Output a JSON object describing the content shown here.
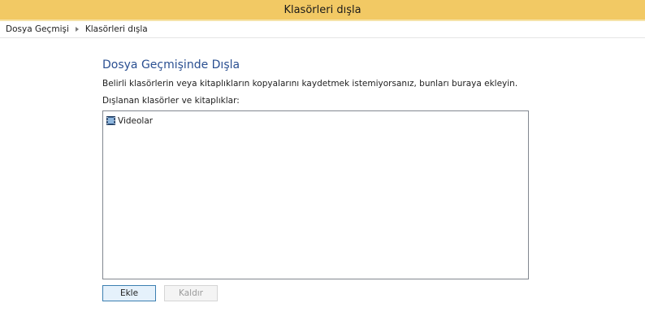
{
  "window": {
    "title": "Klasörleri dışla"
  },
  "breadcrumb": {
    "items": [
      "Dosya Geçmişi",
      "Klasörleri dışla"
    ]
  },
  "main": {
    "heading": "Dosya Geçmişinde Dışla",
    "description": "Belirli klasörlerin veya kitaplıkların kopyalarını kaydetmek istemiyorsanız, bunları buraya ekleyin.",
    "list_label": "Dışlanan klasörler ve kitaplıklar:",
    "excluded_items": [
      {
        "label": "Videolar",
        "icon": "video-library-icon"
      }
    ]
  },
  "buttons": {
    "add_label": "Ekle",
    "remove_label": "Kaldır",
    "remove_enabled": false
  },
  "colors": {
    "titlebar": "#f2c964",
    "heading": "#2a4f91"
  }
}
